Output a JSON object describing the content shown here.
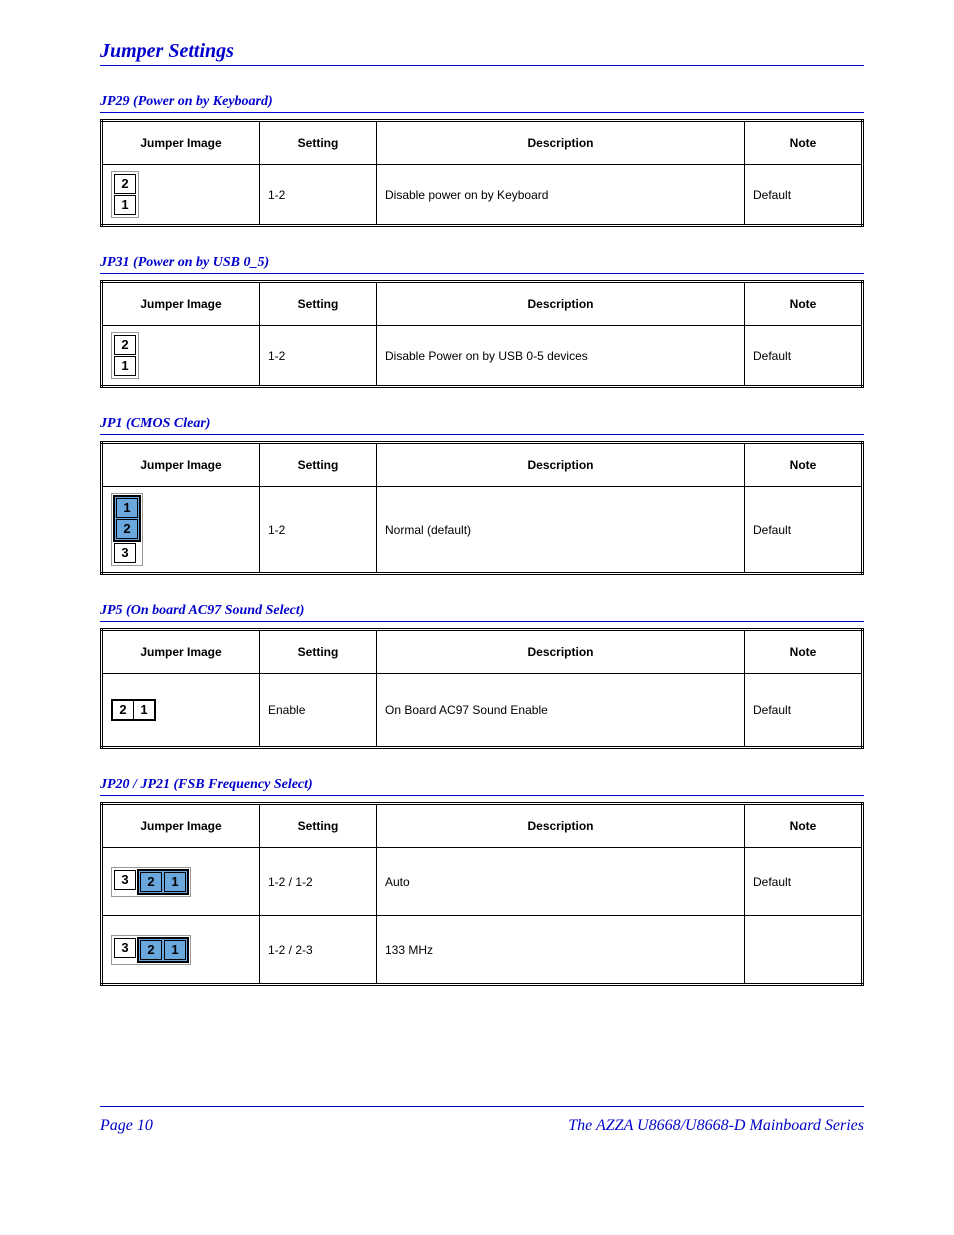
{
  "page": {
    "title": "Jumper Settings"
  },
  "columns": {
    "image": "Jumper Image",
    "setting": "Setting",
    "description": "Description",
    "note": "Note"
  },
  "sections": [
    {
      "title": "JP29 (Power on by Keyboard)",
      "type": "v2",
      "rows": [
        {
          "setting": "1-2",
          "description": "Disable power on by Keyboard",
          "note": "Default"
        }
      ]
    },
    {
      "title": "JP31 (Power on by USB 0_5)",
      "type": "v2",
      "rows": [
        {
          "setting": "1-2",
          "description": "Disable Power on by USB 0-5 devices",
          "note": "Default"
        }
      ]
    },
    {
      "title": "JP1 (CMOS Clear)",
      "type": "v3join12",
      "rows": [
        {
          "setting": "1-2",
          "description": "Normal (default)",
          "note": "Default"
        }
      ]
    },
    {
      "title": "JP5 (On board AC97 Sound Select)",
      "type": "h2",
      "rows": [
        {
          "setting": "Enable",
          "description": "On Board AC97 Sound Enable",
          "note": "Default"
        }
      ]
    },
    {
      "title": "JP20 / JP21 (FSB Frequency Select)",
      "type": "h3join12_double",
      "rows": [
        {
          "setting": "1-2 / 1-2",
          "description": "Auto",
          "note": "Default"
        },
        {
          "setting": "1-2 / 2-3",
          "description": "133 MHz",
          "note": ""
        }
      ]
    }
  ],
  "footer": {
    "left": "Page 10",
    "right": "The AZZA U8668/U8668-D Mainboard Series"
  }
}
